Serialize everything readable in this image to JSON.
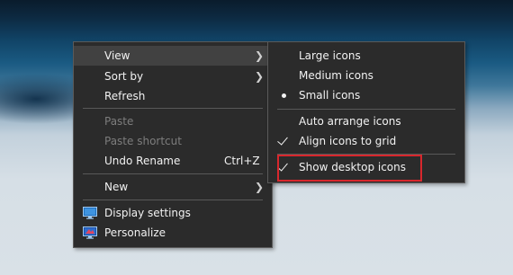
{
  "context_menu": {
    "items": [
      {
        "label": "View"
      },
      {
        "label": "Sort by"
      },
      {
        "label": "Refresh"
      },
      {
        "label": "Paste"
      },
      {
        "label": "Paste shortcut"
      },
      {
        "label": "Undo Rename",
        "shortcut": "Ctrl+Z"
      },
      {
        "label": "New"
      },
      {
        "label": "Display settings",
        "icon": "display-settings-icon"
      },
      {
        "label": "Personalize",
        "icon": "personalize-icon"
      }
    ]
  },
  "view_submenu": {
    "items": [
      {
        "label": "Large icons"
      },
      {
        "label": "Medium icons"
      },
      {
        "label": "Small icons",
        "selected": true
      },
      {
        "label": "Auto arrange icons"
      },
      {
        "label": "Align icons to grid",
        "checked": true
      },
      {
        "label": "Show desktop icons",
        "checked": true
      }
    ]
  },
  "colors": {
    "menu_background": "#2b2b2b",
    "highlight": "#414141",
    "annotation_box": "#d8272d"
  }
}
